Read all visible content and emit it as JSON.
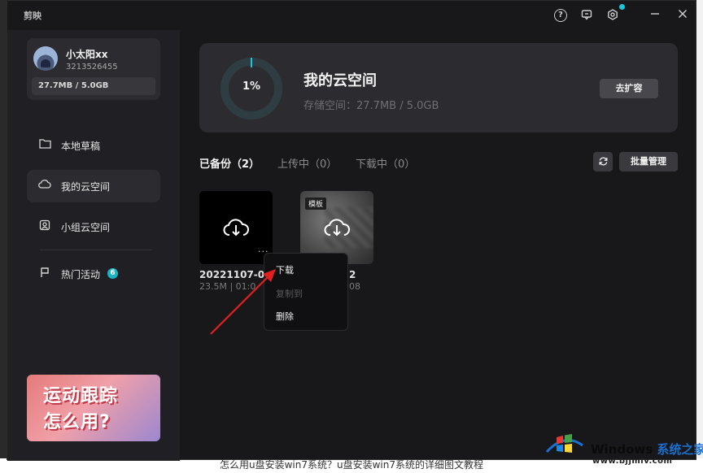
{
  "app": {
    "logo_text": "剪映"
  },
  "titlebar": {
    "help_icon": "question-icon",
    "chat_icon": "feedback-icon",
    "settings_icon": "gear-icon",
    "minimize_icon": "minimize-icon",
    "close_icon": "close-icon",
    "notification_dot_color": "#19c8d8"
  },
  "user": {
    "name": "小太阳xx",
    "id": "3213526455",
    "storage": "27.7MB / 5.0GB"
  },
  "sidebar": {
    "items": [
      {
        "label": "本地草稿",
        "icon": "folder-icon",
        "active": false
      },
      {
        "label": "我的云空间",
        "icon": "cloud-icon",
        "active": true
      },
      {
        "label": "小组云空间",
        "icon": "team-icon",
        "active": false
      },
      {
        "label": "热门活动",
        "icon": "flag-icon",
        "active": false,
        "badge": "6"
      }
    ],
    "promo": {
      "line1": "运动跟踪",
      "line2": "怎么用?"
    }
  },
  "cloud": {
    "percent": "1%",
    "percent_value": 0.01,
    "title": "我的云空间",
    "storage_label": "存储空间：27.7MB / 5.0GB",
    "expand_label": "去扩容",
    "accent_color": "#19c8d8"
  },
  "tabs": [
    {
      "label": "已备份（2）",
      "active": true
    },
    {
      "label": "上传中（0）",
      "active": false
    },
    {
      "label": "下载中（0）",
      "active": false
    }
  ],
  "toolbar": {
    "refresh_icon": "refresh-icon",
    "batch_label": "批量管理"
  },
  "files": [
    {
      "name": "20221107-01",
      "meta": "23.5M | 01:0",
      "tag": ""
    },
    {
      "name": "2",
      "meta": "08",
      "tag": "模板"
    }
  ],
  "context_menu": {
    "items": [
      {
        "label": "下载",
        "enabled": true
      },
      {
        "label": "复制到",
        "enabled": false
      },
      {
        "label": "删除",
        "enabled": true
      }
    ]
  },
  "desktop": {
    "bottom_text": "怎么用u盘安装win7系统？u盘安装win7系统的详细图文教程",
    "watermark_title_a": "Windows ",
    "watermark_title_b": "系统之家",
    "watermark_url": "www.bjjmlv.com"
  }
}
